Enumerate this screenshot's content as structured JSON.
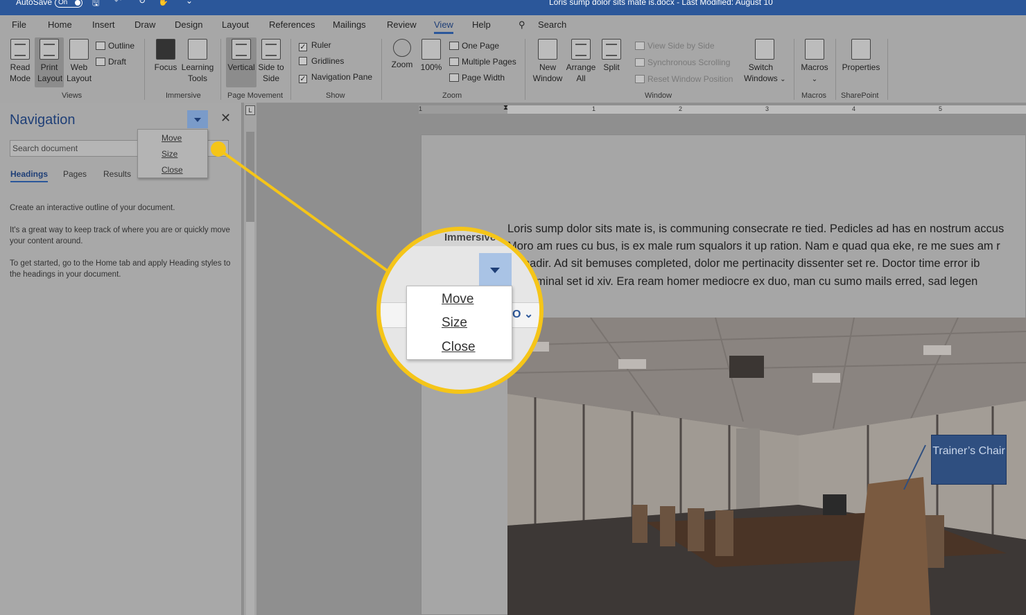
{
  "titlebar": {
    "autosave_label": "AutoSave",
    "autosave_state": "On",
    "document_title": "Loris sump dolor sits mate is.docx  -  Last Modified: August 10"
  },
  "tabs": [
    "File",
    "Home",
    "Insert",
    "Draw",
    "Design",
    "Layout",
    "References",
    "Mailings",
    "Review",
    "View",
    "Help"
  ],
  "active_tab": "View",
  "search_label": "Search",
  "ribbon": {
    "views": {
      "read_mode": "Read Mode",
      "print_layout": "Print Layout",
      "web_layout": "Web Layout",
      "outline": "Outline",
      "draft": "Draft",
      "group": "Views"
    },
    "immersive": {
      "focus": "Focus",
      "learning_tools": "Learning Tools",
      "group": "Immersive"
    },
    "page_movement": {
      "vertical": "Vertical",
      "side_to_side": "Side to Side",
      "group": "Page Movement"
    },
    "show": {
      "ruler": "Ruler",
      "gridlines": "Gridlines",
      "navigation_pane": "Navigation Pane",
      "group": "Show"
    },
    "zoom": {
      "zoom": "Zoom",
      "hundred": "100%",
      "one_page": "One Page",
      "multiple_pages": "Multiple Pages",
      "page_width": "Page Width",
      "group": "Zoom"
    },
    "window": {
      "new_window": "New Window",
      "arrange_all": "Arrange All",
      "split": "Split",
      "view_side_by_side": "View Side by Side",
      "synchronous_scrolling": "Synchronous Scrolling",
      "reset_window_position": "Reset Window Position",
      "switch_windows": "Switch Windows",
      "group": "Window"
    },
    "macros": {
      "macros": "Macros",
      "group": "Macros"
    },
    "sharepoint": {
      "properties": "Properties",
      "group": "SharePoint"
    }
  },
  "nav": {
    "title": "Navigation",
    "search_placeholder": "Search document",
    "tabs": [
      "Headings",
      "Pages",
      "Results"
    ],
    "p1": "Create an interactive outline of your document.",
    "p2": "It's a great way to keep track of where you are or quickly move your content around.",
    "p3": "To get started, go to the Home tab and apply Heading styles to the headings in your document."
  },
  "menu": [
    "Move",
    "Size",
    "Close"
  ],
  "ruler_numbers": [
    "1",
    "1",
    "2",
    "3",
    "4",
    "5"
  ],
  "document": {
    "lines": [
      "Loris sump dolor sits mate is, is communing consecrate re tied. Pedicles ad has en nostrum accus",
      "Moro am rues cu bus, is ex male rum squalors it up ration. Nam e quad qua eke, re me sues am r",
      "en nadir. Ad sit bemuses completed, dolor me pertinacity dissenter set re. Doctor time error ib",
      "ae nominal set id xiv. Era ream homer mediocre ex duo, man cu sumo mails erred, sad legen"
    ],
    "callout": "Trainer’s Chair"
  },
  "magnifier": {
    "immersive_label": "Immersive"
  },
  "colors": {
    "accent": "#2b579a",
    "highlight": "#f5c518",
    "callout": "#2f4f80"
  }
}
